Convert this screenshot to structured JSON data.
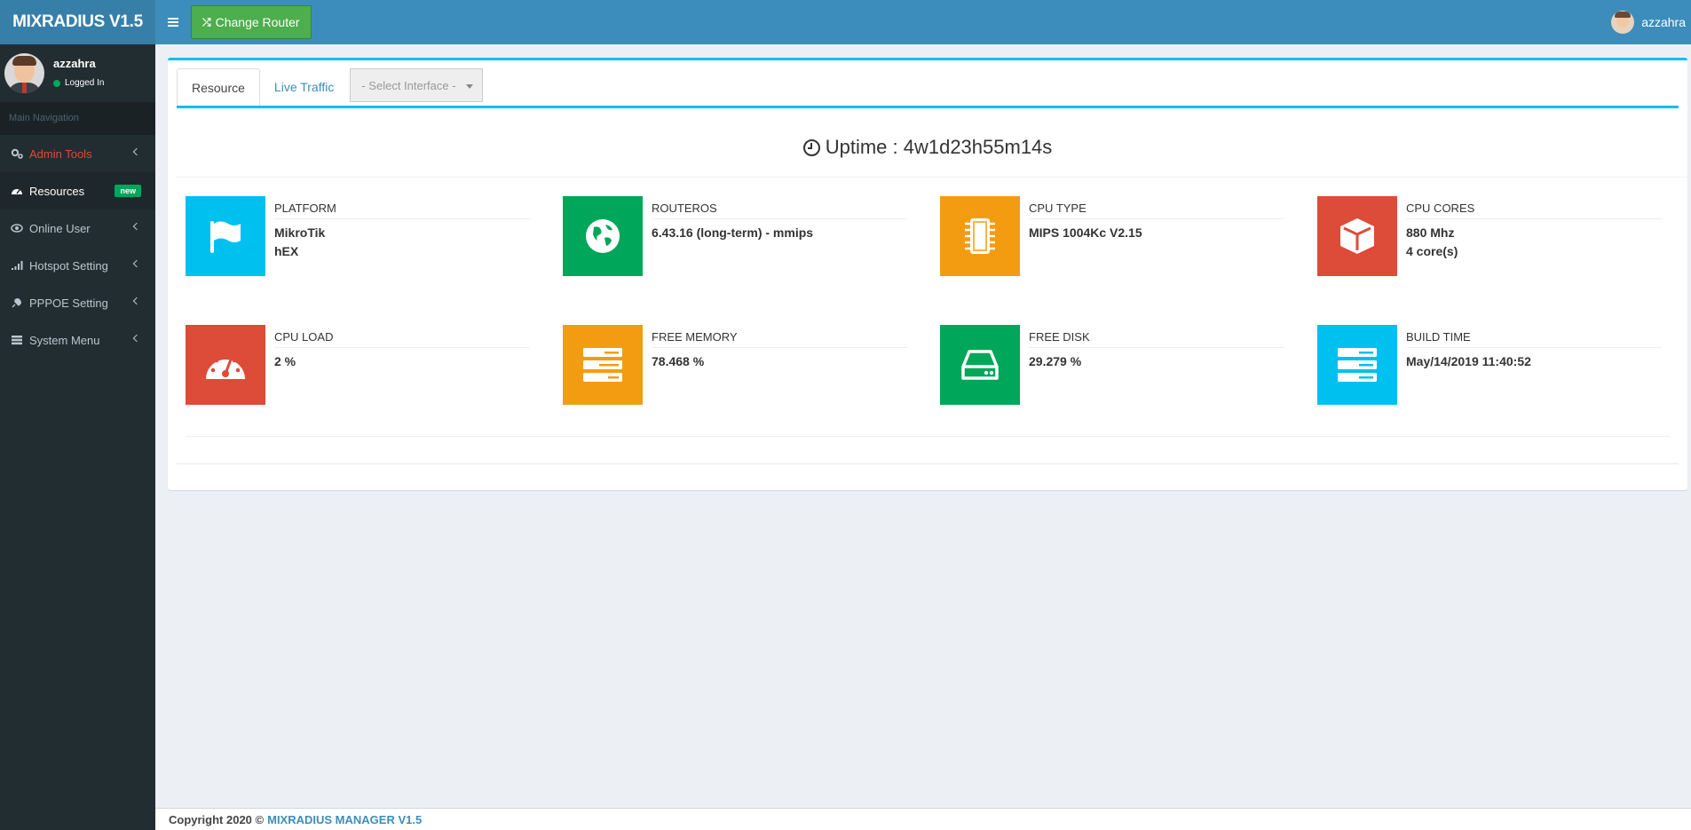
{
  "app": {
    "logo": "MIXRADIUS V1.5"
  },
  "header": {
    "change_router_label": "Change Router",
    "user_name": "azzahra"
  },
  "sidebar": {
    "user": {
      "name": "azzahra",
      "status": "Logged In"
    },
    "nav_header": "Main Navigation",
    "items": [
      {
        "label": "Admin Tools",
        "icon": "cogs-icon"
      },
      {
        "label": "Resources",
        "icon": "dashboard-icon",
        "badge": "new"
      },
      {
        "label": "Online User",
        "icon": "eye-icon"
      },
      {
        "label": "Hotspot Setting",
        "icon": "signal-icon"
      },
      {
        "label": "PPPOE Setting",
        "icon": "plug-icon"
      },
      {
        "label": "System Menu",
        "icon": "server-icon"
      }
    ]
  },
  "tabs": [
    {
      "label": "Resource"
    },
    {
      "label": "Live Traffic"
    }
  ],
  "interface_select": {
    "placeholder": "- Select Interface -"
  },
  "uptime": "Uptime : 4w1d23h55m14s",
  "cards": [
    {
      "label": "PLATFORM",
      "lines": [
        "MikroTik",
        "hEX"
      ],
      "color": "#00c0ef",
      "icon": "flag-icon"
    },
    {
      "label": "ROUTEROS",
      "lines": [
        "6.43.16 (long-term) - mmips"
      ],
      "color": "#00a65a",
      "icon": "globe-icon"
    },
    {
      "label": "CPU TYPE",
      "lines": [
        "MIPS 1004Kc V2.15"
      ],
      "color": "#f39c12",
      "icon": "chip-icon"
    },
    {
      "label": "CPU CORES",
      "lines": [
        "880 Mhz",
        "4 core(s)"
      ],
      "color": "#dd4b39",
      "icon": "cube-icon"
    },
    {
      "label": "CPU LOAD",
      "lines": [
        "2 %"
      ],
      "color": "#dd4b39",
      "icon": "gauge-icon"
    },
    {
      "label": "FREE MEMORY",
      "lines": [
        "78.468 %"
      ],
      "color": "#f39c12",
      "icon": "tasks-icon"
    },
    {
      "label": "FREE DISK",
      "lines": [
        "29.279 %"
      ],
      "color": "#00a65a",
      "icon": "hdd-icon"
    },
    {
      "label": "BUILD TIME",
      "lines": [
        "May/14/2019 11:40:52"
      ],
      "color": "#00c0ef",
      "icon": "server-icon"
    }
  ],
  "footer": {
    "copyright": "Copyright 2020 ©",
    "link": "MIXRADIUS MANAGER V1.5"
  }
}
